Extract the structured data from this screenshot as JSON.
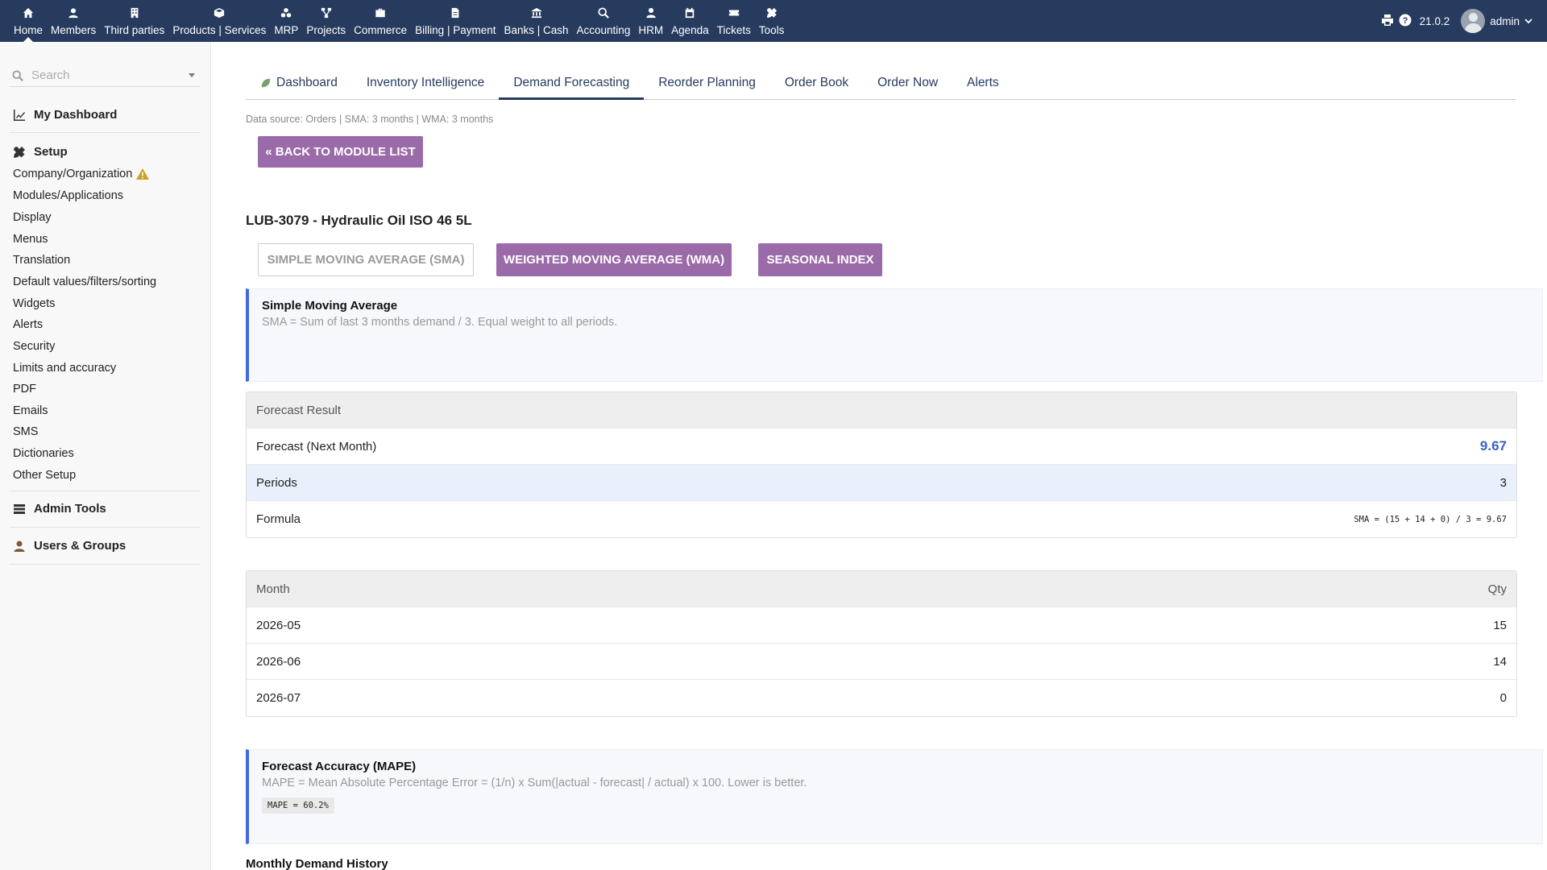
{
  "topnav": [
    {
      "label": "Home",
      "icon": "home-icon",
      "active": true
    },
    {
      "label": "Members",
      "icon": "user-icon"
    },
    {
      "label": "Third parties",
      "icon": "building-icon"
    },
    {
      "label": "Products | Services",
      "icon": "cube-icon"
    },
    {
      "label": "MRP",
      "icon": "cubes-icon"
    },
    {
      "label": "Projects",
      "icon": "sitemap-icon"
    },
    {
      "label": "Commerce",
      "icon": "suitcase-icon"
    },
    {
      "label": "Billing | Payment",
      "icon": "file-icon"
    },
    {
      "label": "Banks | Cash",
      "icon": "bank-icon"
    },
    {
      "label": "Accounting",
      "icon": "search-dollar-icon"
    },
    {
      "label": "HRM",
      "icon": "user-tie-icon"
    },
    {
      "label": "Agenda",
      "icon": "calendar-icon"
    },
    {
      "label": "Tickets",
      "icon": "ticket-icon"
    },
    {
      "label": "Tools",
      "icon": "tools-icon"
    }
  ],
  "topright": {
    "version": "21.0.2",
    "user": "admin"
  },
  "sidebar": {
    "search_placeholder": "Search",
    "my_dashboard": "My Dashboard",
    "setup": "Setup",
    "items": [
      "Company/Organization",
      "Modules/Applications",
      "Display",
      "Menus",
      "Translation",
      "Default values/filters/sorting",
      "Widgets",
      "Alerts",
      "Security",
      "Limits and accuracy",
      "PDF",
      "Emails",
      "SMS",
      "Dictionaries",
      "Other Setup"
    ],
    "admin_tools": "Admin Tools",
    "users_groups": "Users & Groups"
  },
  "tabs": [
    "Dashboard",
    "Inventory Intelligence",
    "Demand Forecasting",
    "Reorder Planning",
    "Order Book",
    "Order Now",
    "Alerts"
  ],
  "active_tab": "Demand Forecasting",
  "datasource": "Data source: Orders | SMA: 3 months | WMA: 3 months",
  "back_button": "« Back to module list",
  "product_title": "LUB-3079 - Hydraulic Oil ISO 46 5L",
  "method_buttons": {
    "sma": "Simple Moving Average (SMA)",
    "wma": "Weighted Moving Average (WMA)",
    "seasonal": "Seasonal Index"
  },
  "sma_info": {
    "title": "Simple Moving Average",
    "desc": "SMA = Sum of last 3 months demand / 3. Equal weight to all periods."
  },
  "result_table": {
    "header": "Forecast Result",
    "rows": [
      {
        "label": "Forecast (Next Month)",
        "value": "9.67"
      },
      {
        "label": "Periods",
        "value": "3"
      },
      {
        "label": "Formula",
        "value": "SMA = (15 + 14 + 0) / 3 = 9.67"
      }
    ]
  },
  "month_table": {
    "headers": [
      "Month",
      "Qty"
    ],
    "rows": [
      {
        "month": "2026-05",
        "qty": "15"
      },
      {
        "month": "2026-06",
        "qty": "14"
      },
      {
        "month": "2026-07",
        "qty": "0"
      }
    ]
  },
  "mape_info": {
    "title": "Forecast Accuracy (MAPE)",
    "desc": "MAPE = Mean Absolute Percentage Error = (1/n) x Sum(|actual - forecast| / actual) x 100. Lower is better.",
    "value": "MAPE = 60.2%"
  },
  "history_title": "Monthly Demand History",
  "colors": {
    "topbar": "#263b5e",
    "purple": "#9b6ba9",
    "accent_blue": "#4169e1"
  }
}
